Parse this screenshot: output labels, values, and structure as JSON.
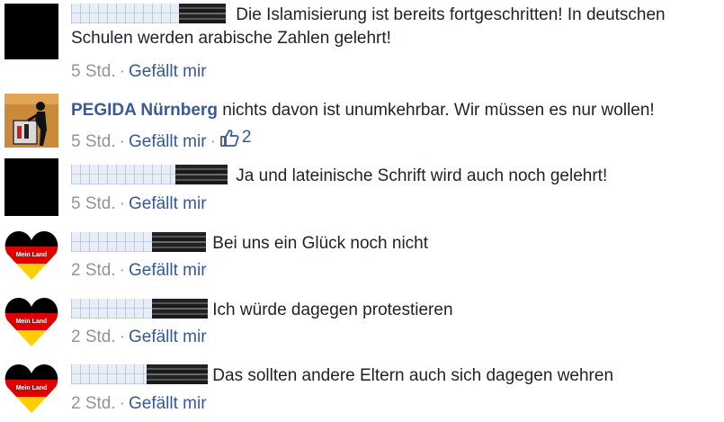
{
  "comments": [
    {
      "author": "",
      "text": "Die Islamisierung ist bereits fortgeschritten! In deutschen Schulen werden arabische Zahlen gelehrt!",
      "time": "5 Std.",
      "separator": "·",
      "like_label": "Gefällt mir",
      "avatar": "black-placeholder"
    },
    {
      "author": "PEGIDA Nürnberg",
      "text": "nichts davon ist unumkehrbar. Wir müssen es nur wollen!",
      "time": "5 Std.",
      "separator": "·",
      "like_label": "Gefällt mir",
      "like_count": "2",
      "avatar": "pegida-logo"
    },
    {
      "author": "",
      "text": "Ja und lateinische Schrift wird auch noch gelehrt!",
      "time": "5 Std.",
      "separator": "·",
      "like_label": "Gefällt mir",
      "avatar": "black-placeholder"
    },
    {
      "author": "",
      "text": "Bei uns ein Glück noch nicht",
      "time": "2 Std.",
      "separator": "·",
      "like_label": "Gefällt mir",
      "avatar": "mein-land-heart"
    },
    {
      "author": "",
      "text": "Ich würde dagegen protestieren",
      "time": "2 Std.",
      "separator": "·",
      "like_label": "Gefällt mir",
      "avatar": "mein-land-heart"
    },
    {
      "author": "",
      "text": "Das sollten andere Eltern auch sich dagegen wehren",
      "time": "2 Std.",
      "separator": "·",
      "like_label": "Gefällt mir",
      "avatar": "mein-land-heart"
    }
  ],
  "heart_avatar_label": "Mein Land",
  "colors": {
    "link": "#365899",
    "author": "#3b5998",
    "meta": "#90949c",
    "text": "#1d2129",
    "flag_black": "#000000",
    "flag_red": "#dd0000",
    "flag_gold": "#ffce00"
  },
  "icons": [
    "thumbs-up-icon"
  ]
}
